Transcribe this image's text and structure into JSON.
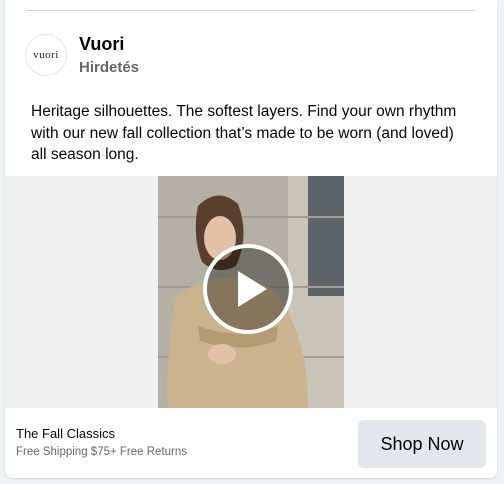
{
  "post": {
    "page_name": "Vuori",
    "avatar_text": "vuori",
    "sponsored_label": "Hirdetés",
    "caption": "Heritage silhouettes. The softest layers. Find your own rhythm with our new fall collection that’s made to be worn (and loved) all season long."
  },
  "media": {
    "play_icon": "play-icon",
    "image_description_icon": "video-thumbnail"
  },
  "footer": {
    "title": "The Fall Classics",
    "subtitle": "Free Shipping $75+ Free Returns",
    "cta_label": "Shop Now"
  },
  "colors": {
    "background": "#f0f2f5",
    "card": "#ffffff",
    "secondary_text": "#65676b",
    "button_bg": "#e4e6eb"
  }
}
